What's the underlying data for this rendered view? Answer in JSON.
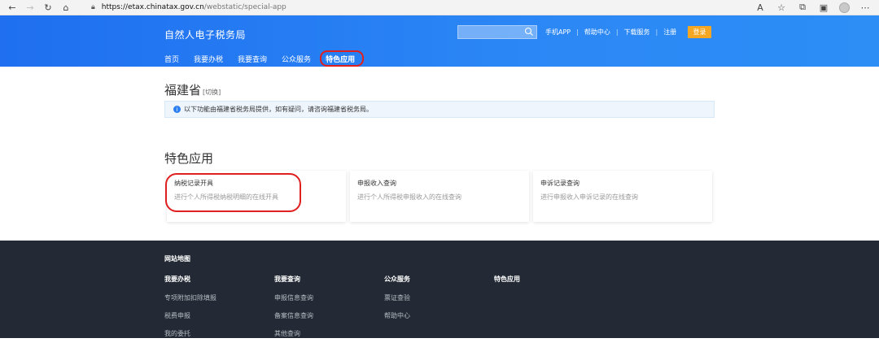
{
  "browser": {
    "url_host": "https://etax.chinatax.gov.cn",
    "url_path": "/webstatic/special-app"
  },
  "header": {
    "title": "自然人电子税务局",
    "search_placeholder": "",
    "links": [
      "手机APP",
      "帮助中心",
      "下载服务",
      "注册"
    ],
    "login": "登录"
  },
  "nav": {
    "items": [
      "首页",
      "我要办税",
      "我要查询",
      "公众服务",
      "特色应用"
    ]
  },
  "content": {
    "province": "福建省",
    "switch": "[切换]",
    "notice": "以下功能由福建省税务局提供，如有疑问，请咨询福建省税务局。",
    "section_title": "特色应用",
    "cards": [
      {
        "title": "纳税记录开具",
        "desc": "进行个人所得税纳税明细的在线开具"
      },
      {
        "title": "申报收入查询",
        "desc": "进行个人所得税申报收入的在线查询"
      },
      {
        "title": "申诉记录查询",
        "desc": "进行申报收入申诉记录的在线查询"
      }
    ]
  },
  "footer": {
    "title": "网站地图",
    "columns": [
      {
        "head": "我要办税",
        "items": [
          "专项附加扣除填报",
          "税费申报",
          "我的委托"
        ]
      },
      {
        "head": "我要查询",
        "items": [
          "申报信息查询",
          "备案信息查询",
          "其他查询"
        ]
      },
      {
        "head": "公众服务",
        "items": [
          "票证查验",
          "帮助中心"
        ]
      },
      {
        "head": "特色应用",
        "items": []
      }
    ]
  },
  "colors": {
    "header_blue": "#2b87f5",
    "login_orange": "#f5a623",
    "annotation_red": "#e01f1f",
    "footer_bg": "#232a35"
  }
}
